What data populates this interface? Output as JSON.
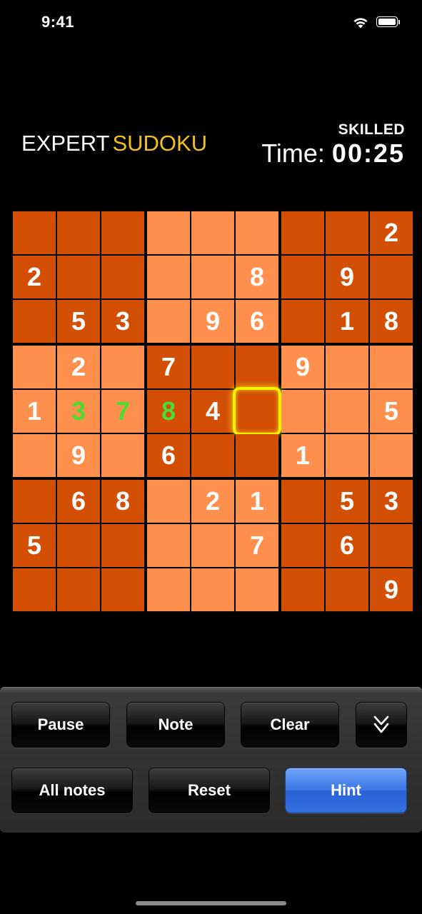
{
  "status_bar": {
    "time": "9:41",
    "wifi_icon": "wifi-icon",
    "battery_icon": "battery-icon"
  },
  "header": {
    "logo_part1": "EXPERT",
    "logo_part2": "SUDOKU",
    "difficulty": "SKILLED",
    "time_label": "Time:",
    "time_value": "00:25"
  },
  "board": {
    "grid": [
      [
        "",
        "",
        "",
        "",
        "",
        "",
        "",
        "",
        "2"
      ],
      [
        "2",
        "",
        "",
        "",
        "",
        "8",
        "",
        "9",
        ""
      ],
      [
        "",
        "5",
        "3",
        "",
        "9",
        "6",
        "",
        "1",
        "8"
      ],
      [
        "",
        "2",
        "",
        "7",
        "",
        "",
        "9",
        "",
        ""
      ],
      [
        "1",
        "3",
        "7",
        "8",
        "4",
        "",
        "",
        "",
        "5"
      ],
      [
        "",
        "9",
        "",
        "6",
        "",
        "",
        "1",
        "",
        ""
      ],
      [
        "",
        "6",
        "8",
        "",
        "2",
        "1",
        "",
        "5",
        "3"
      ],
      [
        "5",
        "",
        "",
        "",
        "",
        "7",
        "",
        "6",
        ""
      ],
      [
        "",
        "",
        "",
        "",
        "",
        "",
        "",
        "",
        "9"
      ]
    ],
    "user_entries": [
      [
        4,
        1
      ],
      [
        4,
        2
      ],
      [
        4,
        3
      ]
    ],
    "selected_cell": [
      4,
      5
    ],
    "colors": {
      "dark_block": "#d24f05",
      "light_block": "#fe8f4d",
      "given_digit": "#ffffff",
      "user_digit": "#4bdd31",
      "selection": "#f7f000"
    }
  },
  "toolbar": {
    "pause_label": "Pause",
    "note_label": "Note",
    "clear_label": "Clear",
    "collapse_icon": "chevron-double-down-icon",
    "all_notes_label": "All notes",
    "reset_label": "Reset",
    "hint_label": "Hint",
    "hint_color": "#3d79e6"
  }
}
